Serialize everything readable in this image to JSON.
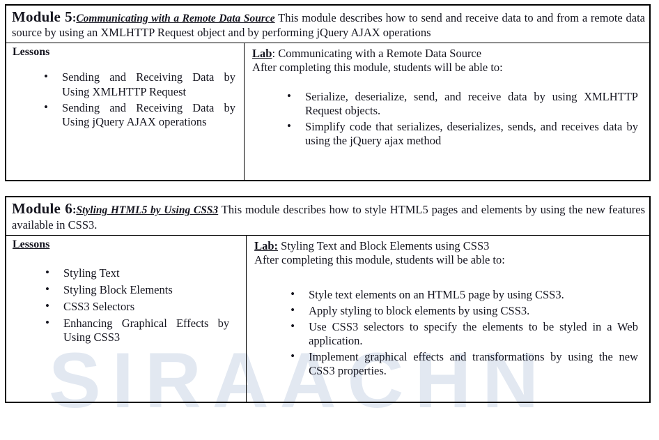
{
  "watermark": {
    "text": "SIRAACHN"
  },
  "modules": [
    {
      "label": "Module 5",
      "colon": ":",
      "title": "Communicating with a Remote Data Source",
      "description": " This module describes how to send and receive data to and from a remote data source by using an XMLHTTP Request object and by performing jQuery AJAX operations",
      "lessons": {
        "heading": "Lessons",
        "items": [
          "Sending and Receiving Data by Using XMLHTTP Request",
          "Sending and Receiving Data by Using jQuery AJAX operations"
        ]
      },
      "lab": {
        "tag": "Lab",
        "separator": ": ",
        "title": "Communicating with a Remote Data Source",
        "intro": "After completing this module, students will be able to:",
        "objectives": [
          "Serialize, deserialize, send, and receive data by using XMLHTTP Request objects.",
          "Simplify code that serializes, deserializes, sends, and receives data by using the jQuery ajax method"
        ]
      }
    },
    {
      "label": "Module 6",
      "colon": ":",
      "title": "Styling HTML5 by Using CSS3",
      "description": " This module describes how to style HTML5 pages and elements by using the new features available in CSS3.",
      "lessons": {
        "heading": "Lessons",
        "items": [
          "Styling Text",
          "Styling Block Elements",
          "CSS3 Selectors",
          "Enhancing Graphical Effects by Using CSS3"
        ]
      },
      "lab": {
        "tag": "Lab:",
        "separator": " ",
        "title": "Styling Text and Block Elements using CSS3",
        "intro": "After completing this module, students will be able to:",
        "objectives": [
          "Style text elements on an HTML5 page by using CSS3.",
          "Apply styling to block elements by using CSS3.",
          "Use CSS3 selectors to specify the elements to be styled in a Web application.",
          "Implement graphical effects and transformations by using the new CSS3 properties."
        ]
      }
    }
  ]
}
